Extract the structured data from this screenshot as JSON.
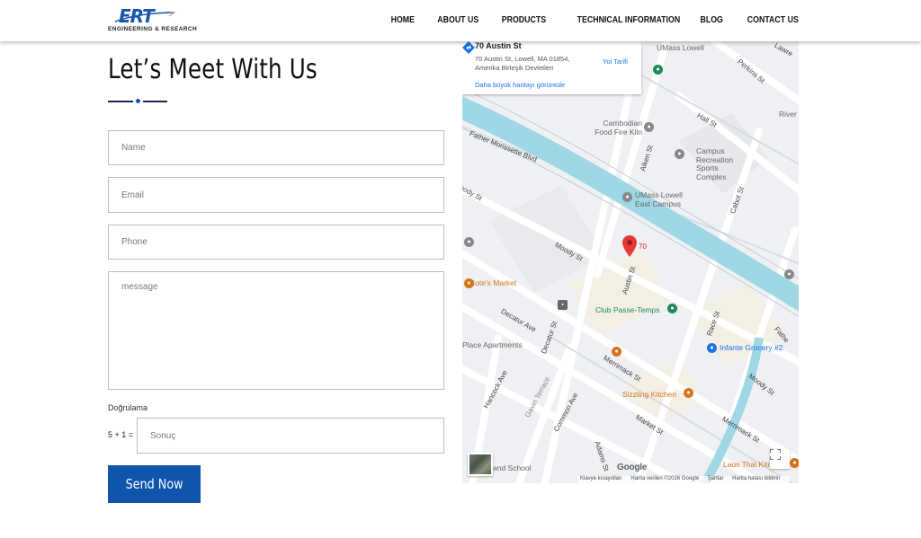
{
  "header": {
    "logo_text": "ERT",
    "logo_subtitle": "ENGINEERING & RESEARCH",
    "nav": [
      "HOME",
      "ABOUT US",
      "PRODUCTS",
      "TECHNICAL INFORMATION",
      "BLOG",
      "CONTACT US"
    ]
  },
  "contact": {
    "title": "Let’s Meet With Us",
    "name_placeholder": "Name",
    "email_placeholder": "Email",
    "phone_placeholder": "Phone",
    "message_placeholder": "message",
    "verify_label": "Doğrulama",
    "captcha_question": "5 + 1 =",
    "captcha_placeholder": "Sonuç",
    "submit_label": "Send Now"
  },
  "map": {
    "place_title": "70 Austin St",
    "place_address": "70 Austin St, Lowell, MA 01854, Amerika Birleşik Devletleri",
    "larger_map_link": "Daha büyük haritayı görüntüle",
    "directions_label": "Yol Tarifi",
    "marker_label": "70",
    "places": {
      "umass_lowell": "UMass Lowell",
      "cambodian": "Cambodian Food Fire Kiln",
      "campus_rec": "Campus Recreation Sports Complex",
      "umass_east": "UMass Lowell East Campus",
      "cotes": "Cote's Market",
      "club": "Club Passe-Temps",
      "infante": "Infante Grocery #2",
      "sizzling": "Sizzling Kitchen",
      "laos": "Laos Thai Kitc",
      "place_apts": "Place Apartments",
      "river": "River",
      "and_school": "and School"
    },
    "streets": {
      "father_morissette": "Father Morissette Blvd",
      "moody_st": "Moody St",
      "austin_st": "Austin St",
      "aiken_st": "Aiken St",
      "hall_st": "Hall St",
      "perkins_st": "Perkins St",
      "cabot_st": "Cabot St",
      "decatur_ave": "Decatur Ave",
      "decatur_st": "Decatur St",
      "race_st": "Race St",
      "merrimack_st": "Merrimack St",
      "market_st": "Market St",
      "hancock_ave": "Hancock Ave",
      "gavin_terrace": "Gavin Terrace",
      "common_ave": "Common Ave",
      "adams_st": "Adams St",
      "moody_st_2": "Moody St",
      "merrimack_st_2": "Merrimack St",
      "lawrence": "Lawre",
      "father": "Fathe",
      "moody_partial": "oody St"
    },
    "google": "Google",
    "attribution": [
      "Klavye kısayolları",
      "Harita verileri ©2026 Google",
      "Şartlar",
      "Harita hatası bildirin"
    ]
  },
  "colors": {
    "brand_blue": "#0f55ad",
    "water": "#9fd7e4",
    "pin_red": "#e53935"
  }
}
